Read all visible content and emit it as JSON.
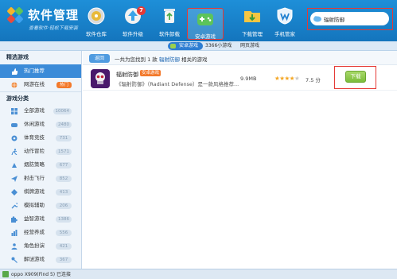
{
  "app": {
    "title": "软件管理",
    "slogan": "查看软件·轻松下载安装"
  },
  "nav": [
    {
      "id": "software-store",
      "label": "软件仓库",
      "icon": "disc-icon"
    },
    {
      "id": "software-upgrade",
      "label": "软件升级",
      "icon": "upgrade-icon",
      "badge": "7"
    },
    {
      "id": "software-uninstall",
      "label": "软件卸载",
      "icon": "recycle-icon"
    },
    {
      "id": "android-games",
      "label": "安卓游戏",
      "icon": "gamepad-icon",
      "active": true
    },
    {
      "id": "download-manager",
      "label": "下载管理",
      "icon": "folder-download-icon"
    },
    {
      "id": "phone-steward",
      "label": "手机管家",
      "icon": "shield-icon"
    }
  ],
  "search": {
    "value": "辐射防御"
  },
  "subtabs": {
    "active": "安卓游戏",
    "small_games": "3366小游戏",
    "web_games": "网页游戏"
  },
  "sidebar": {
    "featured_head": "精选游戏",
    "featured": [
      {
        "label": "热门推荐",
        "icon": "thumbs-up-icon",
        "selected": true
      },
      {
        "label": "网游在线",
        "icon": "globe-icon",
        "hot": "热门"
      }
    ],
    "category_head": "游戏分类",
    "categories": [
      {
        "label": "全部游戏",
        "count": "10064",
        "icon": "grid-icon"
      },
      {
        "label": "休闲游戏",
        "count": "2480",
        "icon": "gamepad-icon"
      },
      {
        "label": "体育竞技",
        "count": "731",
        "icon": "ball-icon"
      },
      {
        "label": "动作冒险",
        "count": "1571",
        "icon": "runner-icon"
      },
      {
        "label": "烟防策略",
        "count": "677",
        "icon": "strategy-icon"
      },
      {
        "label": "射击飞行",
        "count": "852",
        "icon": "plane-icon"
      },
      {
        "label": "棋牌游戏",
        "count": "413",
        "icon": "cards-icon"
      },
      {
        "label": "模拟辅助",
        "count": "206",
        "icon": "wrench-icon"
      },
      {
        "label": "益智游戏",
        "count": "1386",
        "icon": "puzzle-icon"
      },
      {
        "label": "经营养成",
        "count": "556",
        "icon": "chart-icon"
      },
      {
        "label": "角色扮演",
        "count": "421",
        "icon": "person-icon"
      },
      {
        "label": "解谜游戏",
        "count": "367",
        "icon": "key-icon"
      }
    ]
  },
  "main": {
    "back_label": "返回",
    "result_prefix": "一共为您找到 1 款",
    "result_keyword": "辐射防御",
    "result_suffix": "相关的游戏",
    "results": [
      {
        "name": "辐射防御",
        "tag": "安卓游戏",
        "description": "《辐射防御》（Radiant Defense）是一款风格推荐...",
        "size": "9.9MB",
        "stars": 4,
        "rating": "7.5 分",
        "download_label": "下载"
      }
    ]
  },
  "status": {
    "device_text": "oppo X909(Find 5) 已连接"
  },
  "colors": {
    "header_blue": "#1e8fd8",
    "highlight_red": "#e53935",
    "download_green": "#7bbd3a",
    "sidebar_selected": "#3b8bd8",
    "hot_orange": "#f3792b"
  }
}
